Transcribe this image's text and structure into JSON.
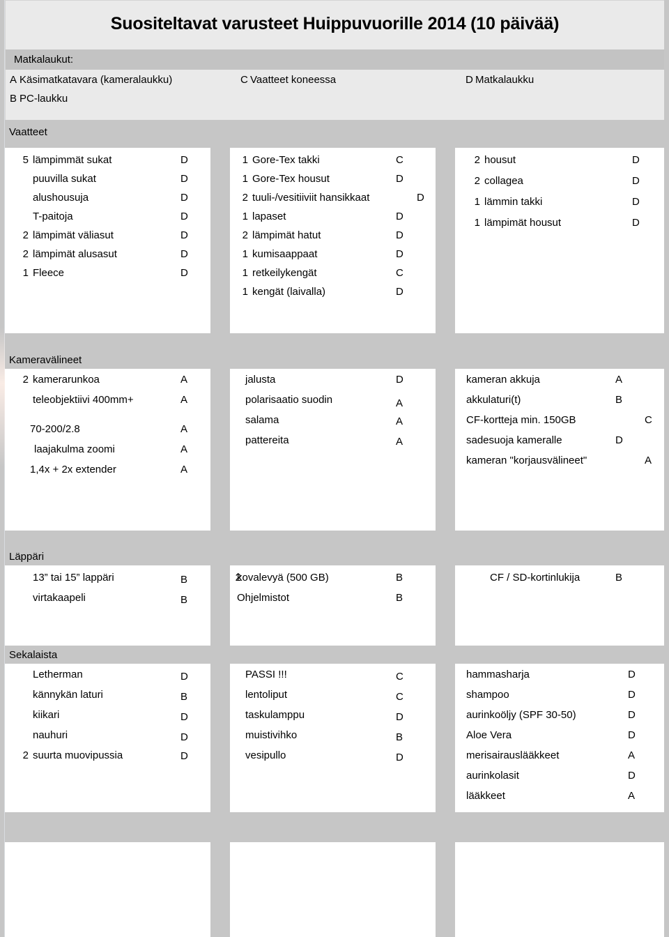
{
  "document": {
    "title": "Suositeltavat varusteet Huippuvuorille 2014 (10 päivää)"
  },
  "bags": {
    "heading": "Matkalaukut:",
    "legend": [
      {
        "code": "A",
        "label": "Käsimatkatavara (kameralaukku)"
      },
      {
        "code": "B",
        "label": "PC-laukku"
      },
      {
        "code": "C",
        "label": "Vaatteet koneessa"
      },
      {
        "code": "D",
        "label": "Matkalaukku"
      }
    ]
  },
  "sections": [
    {
      "heading": "Vaatteet",
      "col1": [
        {
          "qty": "5",
          "name": "lämpimmät sukat",
          "code": "D"
        },
        {
          "qty": "",
          "name": "puuvilla sukat",
          "code": "D"
        },
        {
          "qty": "",
          "name": "alushousuja",
          "code": "D"
        },
        {
          "qty": "",
          "name": "T-paitoja",
          "code": "D"
        },
        {
          "qty": "2",
          "name": "lämpimät väliasut",
          "code": "D"
        },
        {
          "qty": "2",
          "name": "lämpimät alusasut",
          "code": "D"
        },
        {
          "qty": "1",
          "name": "Fleece",
          "code": "D"
        }
      ],
      "col2": [
        {
          "qty": "1",
          "name": "Gore-Tex takki",
          "code": "C"
        },
        {
          "qty": "1",
          "name": "Gore-Tex housut",
          "code": "D"
        },
        {
          "qty": "2",
          "name": "tuuli-/vesitiiviit hansikkaat",
          "code": "D"
        },
        {
          "qty": "1",
          "name": "lapaset",
          "code": "D"
        },
        {
          "qty": "2",
          "name": "lämpimät hatut",
          "code": "D"
        },
        {
          "qty": "1",
          "name": "kumisaappaat",
          "code": "D"
        },
        {
          "qty": "1",
          "name": "retkeilykengät",
          "code": "C"
        },
        {
          "qty": "1",
          "name": "kengät (laivalla)",
          "code": "D"
        }
      ],
      "col3": [
        {
          "qty": "2",
          "name": "housut",
          "code": "D"
        },
        {
          "qty": "2",
          "name": "collagea",
          "code": "D"
        },
        {
          "qty": "1",
          "name": "lämmin takki",
          "code": "D"
        },
        {
          "qty": "1",
          "name": "lämpimät housut",
          "code": "D"
        }
      ]
    },
    {
      "heading": "Kameravälineet",
      "col1": [
        {
          "qty": "2",
          "name": "kamerarunkoa",
          "code": "A"
        },
        {
          "qty": "",
          "name": "teleobjektiivi 400mm+",
          "code": "A"
        },
        {
          "qty": "",
          "name": "70-200/2.8",
          "code": "A"
        },
        {
          "qty": "",
          "name": "laajakulma zoomi",
          "code": "A"
        },
        {
          "qty": "",
          "name": "1,4x + 2x extender",
          "code": "A"
        }
      ],
      "col2": [
        {
          "qty": "",
          "name": "jalusta",
          "code": "D"
        },
        {
          "qty": "",
          "name": "polarisaatio suodin",
          "code": "A"
        },
        {
          "qty": "",
          "name": "salama",
          "code": "A"
        },
        {
          "qty": "",
          "name": "pattereita",
          "code": "A"
        }
      ],
      "col3": [
        {
          "qty": "",
          "name": "kameran akkuja",
          "code": "A"
        },
        {
          "qty": "",
          "name": "akkulaturi(t)",
          "code": "B"
        },
        {
          "qty": "",
          "name": "CF-kortteja  min.  150GB",
          "code": "C"
        },
        {
          "qty": "",
          "name": "sadesuoja  kameralle",
          "code": "D"
        },
        {
          "qty": "",
          "name": "kameran \"korjausvälineet\"",
          "code": "A"
        }
      ]
    },
    {
      "heading": "Läppäri",
      "col1": [
        {
          "qty": "",
          "name": "13” tai 15” lappäri",
          "code": "B"
        },
        {
          "qty": "",
          "name": "virtakaapeli",
          "code": "B"
        }
      ],
      "col2": [
        {
          "qty": "2",
          "name": "kovalevyä (500 GB)",
          "code": "B"
        },
        {
          "qty": "",
          "name": "Ohjelmistot",
          "code": "B"
        }
      ],
      "col3": [
        {
          "qty": "",
          "name": "CF / SD-kortinlukija",
          "code": "B"
        }
      ]
    },
    {
      "heading": "Sekalaista",
      "col1": [
        {
          "qty": "",
          "name": "Letherman",
          "code": "D"
        },
        {
          "qty": "",
          "name": "kännykän laturi",
          "code": "B"
        },
        {
          "qty": "",
          "name": "kiikari",
          "code": "D"
        },
        {
          "qty": "",
          "name": "nauhuri",
          "code": "D"
        },
        {
          "qty": "2",
          "name": "suurta muovipussia",
          "code": "D"
        }
      ],
      "col2": [
        {
          "qty": "",
          "name": "PASSI !!!",
          "code": "C"
        },
        {
          "qty": "",
          "name": "lentoliput",
          "code": "C"
        },
        {
          "qty": "",
          "name": "taskulamppu",
          "code": "D"
        },
        {
          "qty": "",
          "name": "muistivihko",
          "code": "B"
        },
        {
          "qty": "",
          "name": "vesipullo",
          "code": "D"
        }
      ],
      "col3": [
        {
          "qty": "",
          "name": "hammasharja",
          "code": "D"
        },
        {
          "qty": "",
          "name": "shampoo",
          "code": "D"
        },
        {
          "qty": "",
          "name": "aurinkoöljy (SPF 30-50)",
          "code": "D"
        },
        {
          "qty": "",
          "name": "Aloe Vera",
          "code": "D"
        },
        {
          "qty": "",
          "name": "merisairauslääkkeet",
          "code": "A"
        },
        {
          "qty": "",
          "name": "aurinkolasit",
          "code": "D"
        },
        {
          "qty": "",
          "name": "lääkkeet",
          "code": "A"
        }
      ]
    },
    {
      "heading": "",
      "col1": [],
      "col2": [],
      "col3": []
    }
  ],
  "colors": {
    "page_background": "#c6c6c6",
    "header_background": "#eaeaea",
    "section_bar": "#c6c6c6",
    "bags_bar": "#c3c3c3",
    "cell_background": "#ffffff",
    "text": "#000000"
  }
}
